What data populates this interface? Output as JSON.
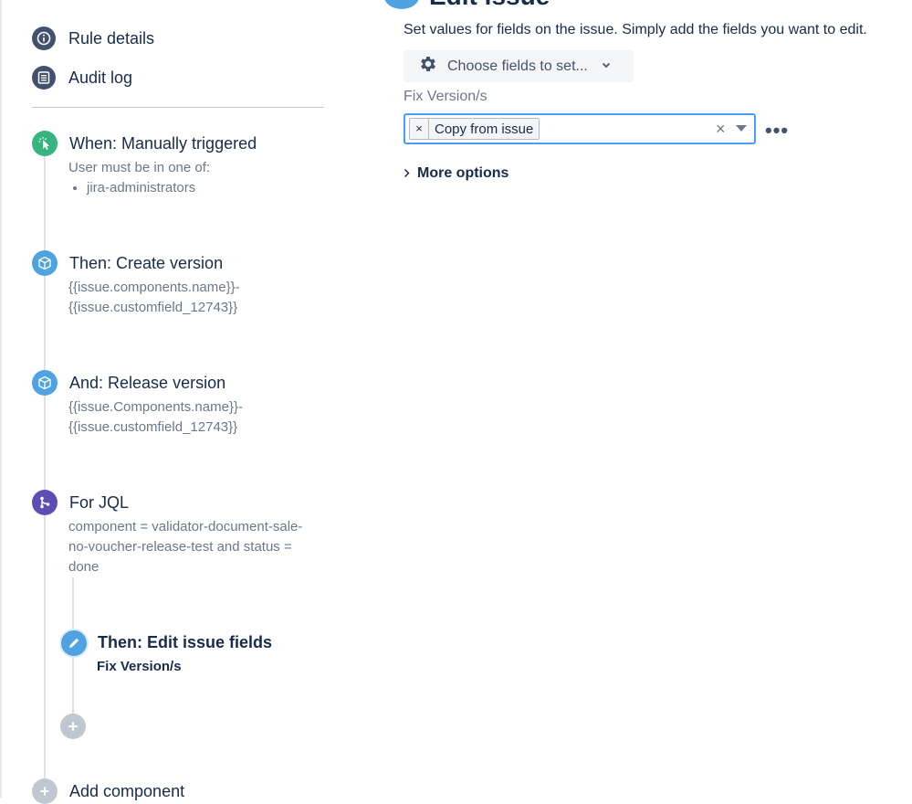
{
  "nav": {
    "rule_details": "Rule details",
    "audit_log": "Audit log"
  },
  "steps": {
    "trigger": {
      "title": "When: Manually triggered",
      "desc": "User must be in one of:",
      "groups": [
        "jira-administrators"
      ]
    },
    "create_version": {
      "title": "Then: Create version",
      "desc_line1": "{{issue.components.name}}-",
      "desc_line2": "{{issue.customfield_12743}}"
    },
    "release_version": {
      "title": "And: Release version",
      "desc_line1": "{{issue.Components.name}}-",
      "desc_line2": "{{issue.customfield_12743}}"
    },
    "for_jql": {
      "title": "For JQL",
      "desc_line1": "component = validator-document-sale-",
      "desc_line2": "no-voucher-release-test and status =",
      "desc_line3": "done"
    },
    "edit_fields": {
      "title": "Then: Edit issue fields",
      "desc": "Fix Version/s"
    },
    "add_component": "Add component"
  },
  "panel": {
    "title": "Edit issue",
    "description": "Set values for fields on the issue. Simply add the fields you want to edit.",
    "choose_fields_label": "Choose fields to set...",
    "field_label": "Fix Version/s",
    "field_tag": "Copy from issue",
    "tag_remove": "×",
    "clear": "×",
    "more_actions": "•••",
    "more_options": "More options"
  },
  "colors": {
    "nav_icon": "#42526e",
    "trigger_green": "#36b37e",
    "action_blue": "#4fa3e0",
    "branch_purple": "#5e4db2",
    "focus_border": "#4c9aff"
  }
}
